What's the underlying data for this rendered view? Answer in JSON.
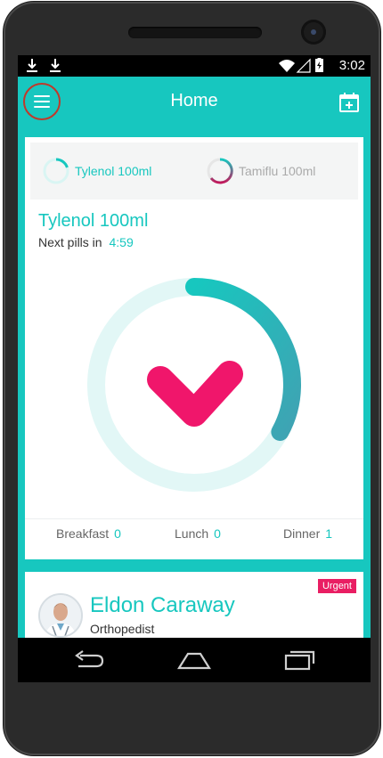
{
  "status_bar": {
    "time": "3:02",
    "icons": [
      "download-icon",
      "download-icon",
      "wifi-icon",
      "signal-icon",
      "battery-icon"
    ]
  },
  "app_bar": {
    "title": "Home",
    "menu_icon": "hamburger-menu-icon",
    "calendar_icon": "calendar-add-icon"
  },
  "medication_tabs": [
    {
      "label": "Tylenol 100ml",
      "active": true,
      "progress": 0.3
    },
    {
      "label": "Tamiflu 100ml",
      "active": false,
      "progress": 0.6
    }
  ],
  "current_medication": {
    "name": "Tylenol 100ml",
    "next_pills_label": "Next pills in",
    "countdown": "4:59",
    "progress": 0.33,
    "status_icon": "heart-check-icon"
  },
  "meals": [
    {
      "label": "Breakfast",
      "count": "0"
    },
    {
      "label": "Lunch",
      "count": "0"
    },
    {
      "label": "Dinner",
      "count": "1"
    }
  ],
  "doctor": {
    "badge": "Urgent",
    "name": "Eldon Caraway",
    "specialty": "Orthopedist"
  },
  "colors": {
    "accent": "#17c7bf",
    "urgent": "#e91e63",
    "heart": "#f0166b"
  },
  "nav_bar": {
    "icons": [
      "back-icon",
      "home-icon",
      "recents-icon"
    ]
  }
}
